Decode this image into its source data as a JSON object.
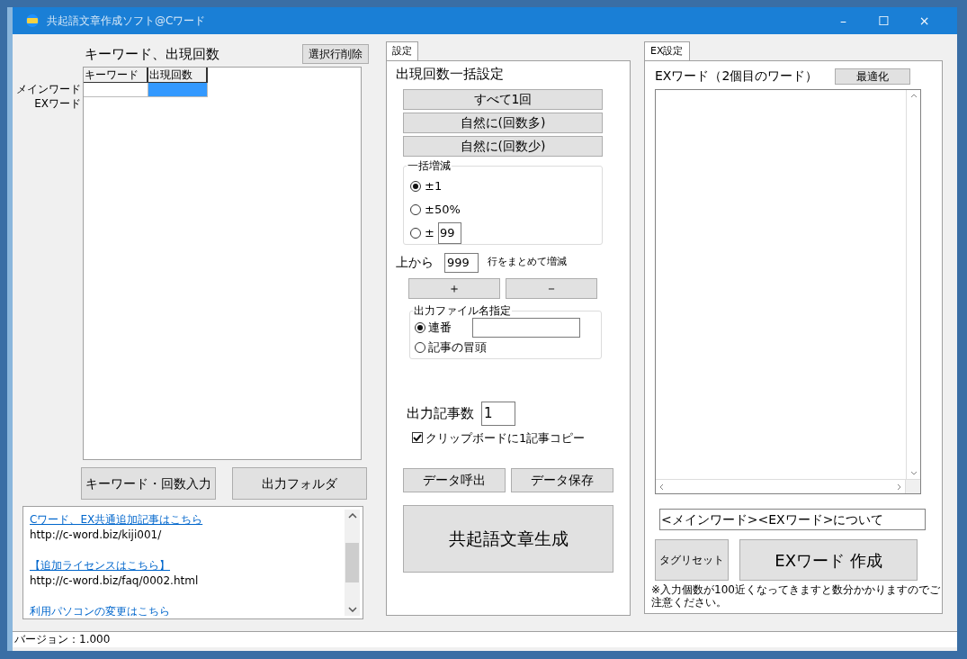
{
  "window": {
    "title": "共起語文章作成ソフト@Cワード",
    "controls": [
      "–",
      "☐",
      "×"
    ]
  },
  "keywords": {
    "title": "キーワード、出現回数",
    "delete_button": "選択行削除",
    "row_labels": [
      "メインワード",
      "EXワード"
    ],
    "columns": [
      "キーワード",
      "出現回数"
    ],
    "rows": [
      {
        "cells": [
          {
            "text": "",
            "selected": false
          },
          {
            "text": "",
            "selected": true
          }
        ]
      }
    ],
    "buttons": [
      "キーワード・回数入力",
      "出力フォルダ"
    ]
  },
  "links": [
    {
      "link": "Cワード、EX共通追加記事はこちら",
      "url": "http://c-word.biz/kiji001/"
    },
    {
      "link": "【追加ライセンスはこちら】",
      "url": "http://c-word.biz/faq/0002.html"
    },
    {
      "link": "利用パソコンの変更はこちら"
    }
  ],
  "settings": {
    "tab": "設定",
    "heading": "出現回数一括設定",
    "preset_buttons": [
      "すべて1回",
      "自然に(回数多)",
      "自然に(回数少)"
    ],
    "bulk_group": {
      "title": "一括増減",
      "options": [
        {
          "label": "±1",
          "selected": true
        },
        {
          "label": "±50%",
          "selected": false
        },
        {
          "label": "±",
          "selected": false,
          "value": "99"
        }
      ]
    },
    "rows_prefix": "上から",
    "rows_value": "999",
    "rows_suffix": "行をまとめて増減",
    "step_buttons": [
      "＋",
      "－"
    ],
    "file_group": {
      "title": "出力ファイル名指定",
      "options": [
        {
          "label": "連番",
          "selected": true,
          "kind": "field"
        },
        {
          "label": "記事の冒頭",
          "selected": false
        }
      ]
    },
    "count_label": "出力記事数",
    "count_value": "1",
    "clipboard": {
      "label": "クリップボードに1記事コピー",
      "checked": true
    },
    "data_buttons": [
      "データ呼出",
      "データ保存"
    ],
    "generate_button": "共起語文章生成"
  },
  "ex": {
    "tab": "EX設定",
    "heading": "EXワード（2個目のワード）",
    "optimize_button": "最適化",
    "template": "<メインワード><EXワード>について",
    "reset_button": "タグリセット",
    "create_button": "EXワード 作成",
    "note": "※入力個数が100近くなってきますと数分かかりますのでご注意ください。"
  },
  "status_bar": {
    "text": "バージョン：1.000"
  }
}
